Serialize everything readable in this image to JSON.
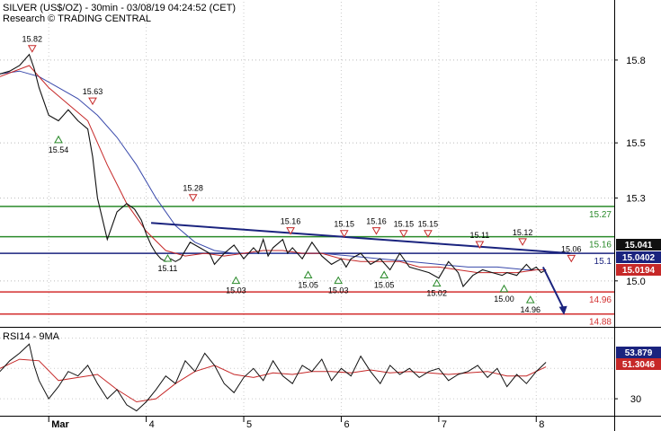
{
  "chart_data": [
    {
      "type": "line",
      "title": "SILVER (US$/OZ) - 30min - 03/08/19 04:24:52 (CET)",
      "subtitle": "Research © TRADING CENTRAL",
      "x_tick_labels": [
        "Mar",
        "4",
        "5",
        "6",
        "7",
        "8"
      ],
      "x_tick_positions": [
        0.5,
        1.5,
        2.5,
        3.5,
        4.5,
        5.5
      ],
      "xlim": [
        0,
        6.3
      ],
      "ylim": [
        14.84,
        15.92
      ],
      "y_ticks": [
        15.0,
        15.3,
        15.5,
        15.8
      ],
      "y_tick_labels": [
        "15.0",
        "15.3",
        "15.5",
        "15.8"
      ],
      "price": {
        "x": [
          0,
          0.1,
          0.2,
          0.25,
          0.3,
          0.35,
          0.4,
          0.5,
          0.6,
          0.65,
          0.7,
          0.8,
          0.9,
          0.95,
          1.0,
          1.1,
          1.2,
          1.3,
          1.38,
          1.45,
          1.5,
          1.55,
          1.6,
          1.65,
          1.7,
          1.75,
          1.8,
          1.85,
          1.95,
          2.05,
          2.15,
          2.2,
          2.3,
          2.4,
          2.5,
          2.6,
          2.65,
          2.7,
          2.75,
          2.8,
          2.9,
          2.95,
          3.0,
          3.1,
          3.2,
          3.3,
          3.4,
          3.5,
          3.55,
          3.6,
          3.7,
          3.8,
          3.9,
          4.0,
          4.1,
          4.2,
          4.3,
          4.4,
          4.5,
          4.6,
          4.7,
          4.75,
          4.85,
          4.95,
          5.05,
          5.15,
          5.2,
          5.3,
          5.35,
          5.4,
          5.45,
          5.5,
          5.55,
          5.6
        ],
        "close": [
          15.75,
          15.76,
          15.78,
          15.8,
          15.82,
          15.77,
          15.7,
          15.6,
          15.58,
          15.6,
          15.62,
          15.58,
          15.55,
          15.45,
          15.3,
          15.15,
          15.25,
          15.28,
          15.26,
          15.22,
          15.17,
          15.13,
          15.1,
          15.08,
          15.07,
          15.08,
          15.07,
          15.08,
          15.14,
          15.12,
          15.1,
          15.06,
          15.1,
          15.13,
          15.08,
          15.12,
          15.1,
          15.15,
          15.09,
          15.12,
          15.15,
          15.1,
          15.12,
          15.08,
          15.14,
          15.09,
          15.06,
          15.08,
          15.05,
          15.08,
          15.1,
          15.06,
          15.08,
          15.04,
          15.1,
          15.05,
          15.04,
          15.03,
          15.01,
          15.07,
          15.03,
          14.98,
          15.02,
          15.04,
          15.03,
          15.02,
          15.03,
          15.02,
          15.04,
          15.06,
          15.04,
          15.05,
          15.03,
          15.04
        ]
      },
      "ma_fast": {
        "x": [
          0,
          0.3,
          0.5,
          0.7,
          0.9,
          1.1,
          1.3,
          1.5,
          1.7,
          1.9,
          2.1,
          2.3,
          2.5,
          2.7,
          2.9,
          3.1,
          3.3,
          3.5,
          3.7,
          3.9,
          4.1,
          4.3,
          4.5,
          4.7,
          4.9,
          5.1,
          5.3,
          5.5,
          5.6
        ],
        "y": [
          15.74,
          15.78,
          15.7,
          15.64,
          15.58,
          15.42,
          15.28,
          15.18,
          15.11,
          15.09,
          15.1,
          15.09,
          15.1,
          15.11,
          15.11,
          15.1,
          15.1,
          15.08,
          15.07,
          15.07,
          15.07,
          15.05,
          15.05,
          15.04,
          15.03,
          15.03,
          15.03,
          15.04,
          15.04
        ]
      },
      "ma_slow": {
        "x": [
          0,
          0.2,
          0.4,
          0.6,
          0.8,
          1.0,
          1.2,
          1.4,
          1.6,
          1.8,
          2.0,
          2.2,
          2.4,
          2.6,
          2.8,
          3.0,
          3.3,
          3.6,
          3.9,
          4.2,
          4.5,
          4.8,
          5.1,
          5.4,
          5.6
        ],
        "y": [
          15.75,
          15.76,
          15.74,
          15.7,
          15.66,
          15.6,
          15.52,
          15.42,
          15.3,
          15.2,
          15.14,
          15.11,
          15.1,
          15.1,
          15.1,
          15.1,
          15.1,
          15.09,
          15.08,
          15.07,
          15.06,
          15.05,
          15.05,
          15.04,
          15.04
        ]
      },
      "horizontal_levels": [
        {
          "value": 15.27,
          "label": "15.27",
          "color": "#2a8a2a"
        },
        {
          "value": 15.16,
          "label": "15.16",
          "color": "#2a8a2a"
        },
        {
          "value": 15.1,
          "label": "15.1",
          "color": "#1a237e"
        },
        {
          "value": 14.96,
          "label": "14.96",
          "color": "#d32f2f"
        },
        {
          "value": 14.88,
          "label": "14.88",
          "color": "#d32f2f"
        }
      ],
      "trendline": {
        "x": [
          1.55,
          5.85
        ],
        "y": [
          15.21,
          15.1
        ],
        "color": "#1a237e"
      },
      "forecast_arrow": {
        "x": [
          5.57,
          5.78
        ],
        "y": [
          15.05,
          14.88
        ],
        "color": "#1a237e"
      },
      "swing_highs": [
        {
          "x": 0.33,
          "y": 15.82,
          "label": "15.82"
        },
        {
          "x": 0.95,
          "y": 15.63,
          "label": "15.63"
        },
        {
          "x": 1.98,
          "y": 15.28,
          "label": "15.28"
        },
        {
          "x": 2.98,
          "y": 15.16,
          "label": "15.16"
        },
        {
          "x": 3.53,
          "y": 15.15,
          "label": "15.15"
        },
        {
          "x": 3.86,
          "y": 15.16,
          "label": "15.16"
        },
        {
          "x": 4.14,
          "y": 15.15,
          "label": "15.15"
        },
        {
          "x": 4.39,
          "y": 15.15,
          "label": "15.15"
        },
        {
          "x": 4.92,
          "y": 15.11,
          "label": "15.11"
        },
        {
          "x": 5.36,
          "y": 15.12,
          "label": "15.12"
        },
        {
          "x": 5.86,
          "y": 15.06,
          "label": "15.06"
        }
      ],
      "swing_lows": [
        {
          "x": 0.6,
          "y": 15.54,
          "label": "15.54"
        },
        {
          "x": 1.72,
          "y": 15.11,
          "label": "15.11"
        },
        {
          "x": 2.42,
          "y": 15.03,
          "label": "15.03"
        },
        {
          "x": 3.16,
          "y": 15.05,
          "label": "15.05"
        },
        {
          "x": 3.47,
          "y": 15.03,
          "label": "15.03"
        },
        {
          "x": 3.94,
          "y": 15.05,
          "label": "15.05"
        },
        {
          "x": 4.48,
          "y": 15.02,
          "label": "15.02"
        },
        {
          "x": 5.17,
          "y": 15.0,
          "label": "15.00"
        },
        {
          "x": 5.44,
          "y": 14.96,
          "label": "14.96"
        }
      ],
      "last_price_badges": [
        {
          "label": "15.041",
          "value": 15.041,
          "color": "#111111"
        },
        {
          "label": "15.0402",
          "value": 15.0402,
          "color": "#1a237e"
        },
        {
          "label": "15.0194",
          "value": 15.0194,
          "color": "#c62828"
        }
      ]
    },
    {
      "type": "line",
      "title": "RSI14 - 9MA",
      "ylim": [
        20,
        75
      ],
      "y_ticks": [
        30
      ],
      "y_tick_labels": [
        "30"
      ],
      "rsi": {
        "x": [
          0,
          0.1,
          0.2,
          0.3,
          0.35,
          0.4,
          0.5,
          0.6,
          0.7,
          0.8,
          0.9,
          1.0,
          1.1,
          1.2,
          1.3,
          1.4,
          1.5,
          1.6,
          1.7,
          1.8,
          1.9,
          2.0,
          2.1,
          2.2,
          2.3,
          2.4,
          2.5,
          2.6,
          2.7,
          2.8,
          2.9,
          3.0,
          3.1,
          3.2,
          3.3,
          3.4,
          3.5,
          3.6,
          3.7,
          3.8,
          3.9,
          4.0,
          4.1,
          4.2,
          4.3,
          4.4,
          4.5,
          4.6,
          4.7,
          4.8,
          4.9,
          5.0,
          5.1,
          5.2,
          5.3,
          5.4,
          5.5,
          5.6
        ],
        "y": [
          48,
          55,
          60,
          66,
          52,
          42,
          30,
          38,
          48,
          45,
          52,
          40,
          30,
          36,
          26,
          22,
          28,
          36,
          45,
          40,
          55,
          48,
          60,
          52,
          40,
          34,
          44,
          50,
          42,
          55,
          45,
          40,
          52,
          48,
          56,
          42,
          50,
          45,
          58,
          48,
          40,
          52,
          46,
          50,
          44,
          48,
          50,
          42,
          46,
          48,
          52,
          44,
          50,
          38,
          46,
          40,
          48,
          54
        ]
      },
      "rsi_ma": {
        "x": [
          0,
          0.2,
          0.4,
          0.6,
          0.8,
          1.0,
          1.2,
          1.4,
          1.6,
          1.8,
          2.0,
          2.2,
          2.4,
          2.6,
          2.8,
          3.0,
          3.2,
          3.4,
          3.6,
          3.8,
          4.0,
          4.2,
          4.4,
          4.6,
          4.8,
          5.0,
          5.2,
          5.4,
          5.6
        ],
        "y": [
          50,
          56,
          55,
          42,
          44,
          46,
          36,
          28,
          30,
          40,
          48,
          52,
          46,
          44,
          47,
          46,
          48,
          48,
          47,
          49,
          47,
          48,
          47,
          46,
          47,
          48,
          45,
          45,
          51
        ]
      },
      "badges": [
        {
          "label": "53.879",
          "value": 53.879,
          "color": "#1a237e"
        },
        {
          "label": "51.3046",
          "value": 51.3046,
          "color": "#c62828"
        }
      ]
    }
  ]
}
